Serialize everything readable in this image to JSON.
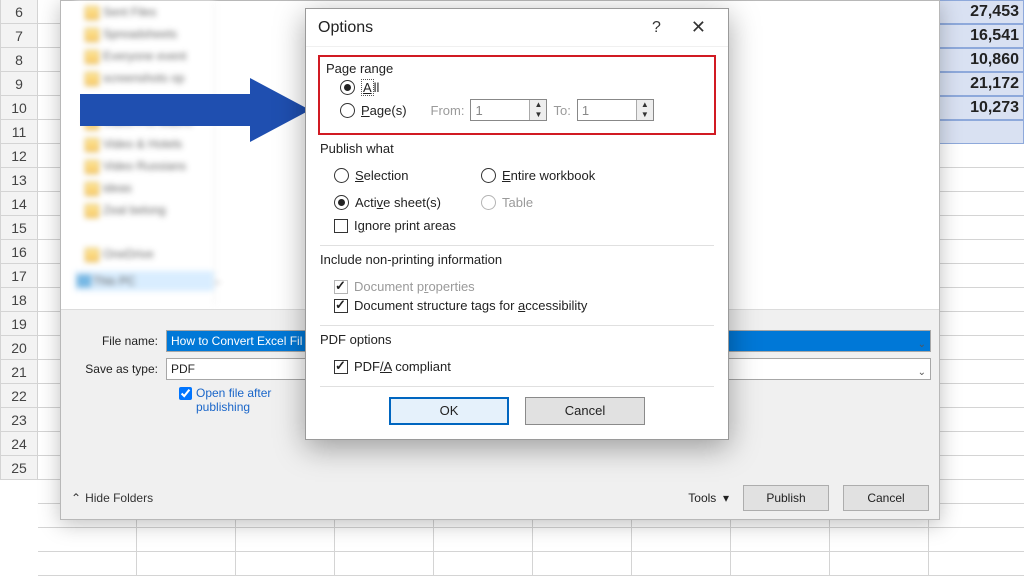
{
  "rows": [
    "6",
    "7",
    "8",
    "9",
    "10",
    "11",
    "12",
    "13",
    "14",
    "15",
    "16",
    "17",
    "18",
    "19",
    "20",
    "21",
    "22",
    "23",
    "24",
    "25"
  ],
  "data_values": [
    "27,453",
    "16,541",
    "10,860",
    "21,172",
    "10,273"
  ],
  "tree_blur_items": [
    "Sent Files",
    "Spreadsheets",
    "Everyone event",
    "screenshots op",
    "",
    "Video Pro Macro",
    "Video & Hotels",
    "Video Russians",
    "ideas",
    "Zeal belong",
    "",
    "OneDrive"
  ],
  "tree_this_pc": "This PC",
  "save": {
    "file_name_label": "File name:",
    "file_name_value": "How to Convert Excel Fil",
    "save_type_label": "Save as type:",
    "save_type_value": "PDF",
    "open_after": "Open file after publishing",
    "hide_folders": "Hide Folders",
    "tools": "Tools",
    "publish": "Publish",
    "cancel": "Cancel"
  },
  "opt": {
    "title": "Options",
    "page_range": "Page range",
    "all_prefix": "A",
    "all_rest": "ll",
    "pages_u": "P",
    "pages_rest": "age(s)",
    "from": "From:",
    "to": "To:",
    "from_val": "1",
    "to_val": "1",
    "publish_what": "Publish what",
    "selection_u": "S",
    "selection_rest": "election",
    "entire_u": "E",
    "entire_rest": "ntire workbook",
    "active_pre": "Acti",
    "active_u": "v",
    "active_post": "e sheet(s)",
    "table_u": "T",
    "table_rest": "able",
    "ignore_pre": "I",
    "ignore_u": "g",
    "ignore_post": "nore print areas",
    "include": "Include non-printing information",
    "docprops_pre": "Document p",
    "docprops_u": "r",
    "docprops_post": "operties",
    "docstruct_pre": "Document structure tags for ",
    "docstruct_u": "a",
    "docstruct_post": "ccessibility",
    "pdf_options": "PDF options",
    "pdfa_pre": "PDF",
    "pdfa_u": "/A",
    "pdfa_post": " compliant",
    "ok": "OK",
    "cancel": "Cancel"
  }
}
